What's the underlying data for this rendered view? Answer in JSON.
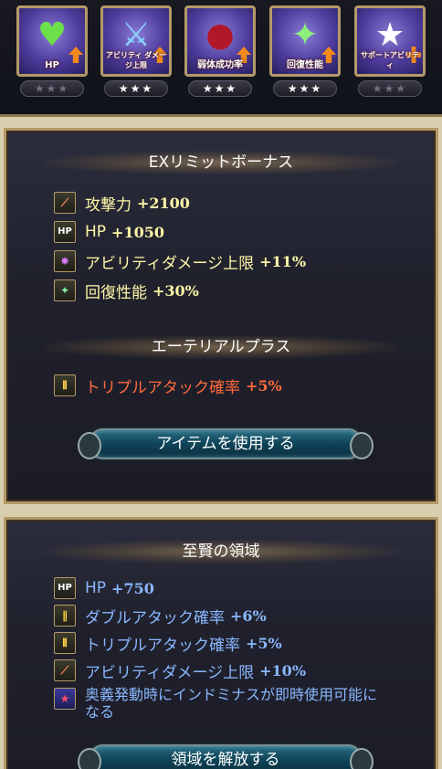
{
  "skills": [
    {
      "caption": "HP",
      "glyph": "♥",
      "glyph_color": "#6ee04a",
      "stars": "★★★",
      "star_color": "#6f6f80"
    },
    {
      "caption": "アビリティ ダメージ上限",
      "glyph": "⚔",
      "glyph_color": "#8ad4ff",
      "stars": "★★★",
      "star_color": "#ffffff"
    },
    {
      "caption": "弱体成功率",
      "glyph": "●",
      "glyph_color": "#b3182a",
      "stars": "★★★",
      "star_color": "#ffffff"
    },
    {
      "caption": "回復性能",
      "glyph": "✦",
      "glyph_color": "#8cf07a",
      "stars": "★★★",
      "star_color": "#ffffff"
    },
    {
      "caption": "サポートアビリティ",
      "glyph": "★",
      "glyph_color": "#ffffff",
      "stars": "★★★",
      "star_color": "#6f6f80"
    }
  ],
  "ex_bonus": {
    "title": "EXリミットボーナス",
    "rows": [
      {
        "icon": "attack-icon",
        "label": "攻撃力",
        "value": "+2100"
      },
      {
        "icon": "hp-icon",
        "label": "HP",
        "value": "+1050"
      },
      {
        "icon": "ability-damage-icon",
        "label": "アビリティダメージ上限",
        "value": "+11%"
      },
      {
        "icon": "heal-icon",
        "label": "回復性能",
        "value": "+30%"
      }
    ]
  },
  "aetherial": {
    "title": "エーテリアルプラス",
    "row": {
      "icon": "triple-attack-icon",
      "label": "トリプルアタック確率",
      "value": "+5%"
    }
  },
  "use_item_button": "アイテムを使用する",
  "domain": {
    "title": "至賢の領域",
    "rows": [
      {
        "icon": "hp-icon",
        "label": "HP",
        "value": "+750"
      },
      {
        "icon": "double-attack-icon",
        "label": "ダブルアタック確率",
        "value": "+6%"
      },
      {
        "icon": "triple-attack-icon",
        "label": "トリプルアタック確率",
        "value": "+5%"
      },
      {
        "icon": "ability-damage-icon",
        "label": "アビリティダメージ上限",
        "value": "+10%"
      }
    ],
    "note_line1": "奥義発動時にインドミナスが即時使用可能に",
    "note_line2": "なる",
    "release_button": "領域を解放する"
  },
  "icon_text": {
    "hp": "HP"
  },
  "colors": {
    "bonus": "#fff7a8",
    "aetherial": "#ff6a3d",
    "domain": "#8ab7ff",
    "frame": "#b49a6a"
  }
}
